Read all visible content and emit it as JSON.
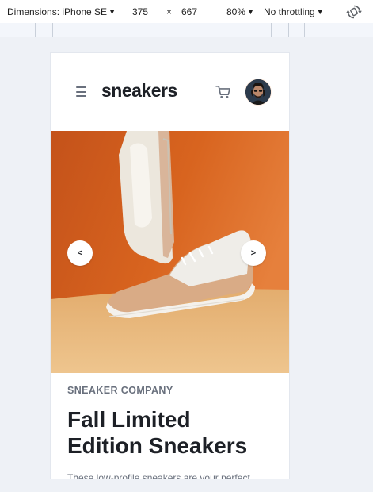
{
  "devtools": {
    "dimensions_label": "Dimensions: iPhone SE",
    "width_value": "375",
    "times": "×",
    "height_value": "667",
    "zoom_label": "80%",
    "throttle_label": "No throttling",
    "icons": {
      "dropdown": "caret-down-icon",
      "rotate": "rotate-icon"
    }
  },
  "site": {
    "logo": "sneakers",
    "icons": {
      "menu": "hamburger-icon",
      "cart": "cart-icon",
      "avatar": "avatar"
    },
    "carousel": {
      "prev_label": "<",
      "next_label": ">"
    },
    "product": {
      "company": "SNEAKER COMPANY",
      "title_line1": "Fall Limited",
      "title_line2": "Edition Sneakers",
      "description": "These low-profile sneakers are your perfect"
    }
  },
  "colors": {
    "accent": "#ff7e1b",
    "dark_text": "#1d2026",
    "muted_text": "#69707d",
    "hero_orange": "#d45f1e",
    "hero_floor": "#e9b97d"
  }
}
